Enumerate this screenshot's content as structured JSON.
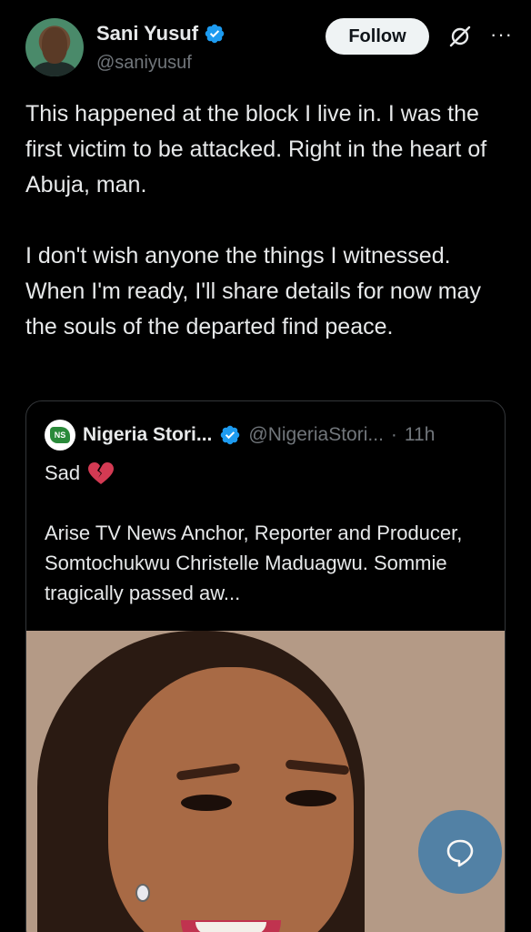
{
  "author": {
    "name": "Sani Yusuf",
    "handle": "@saniyusuf",
    "verified": true
  },
  "actions": {
    "follow_label": "Follow",
    "grok_icon": "grok-icon",
    "more_icon": "more-icon",
    "more_label": "···"
  },
  "tweet": {
    "paragraph1": "This happened at the block I live in. I was the first victim to be attacked. Right in the heart of Abuja, man.",
    "paragraph2": "I don't wish anyone the things I witnessed. When I'm ready, I'll share details for now may the souls of the departed find peace."
  },
  "quoted_tweet": {
    "name": "Nigeria Stori...",
    "handle": "@NigeriaStori...",
    "separator": "·",
    "time": "11h",
    "verified": true,
    "first_line": "Sad",
    "emoji": "broken-heart-icon",
    "body": "Arise TV News Anchor, Reporter and Producer, Somtochukwu Christelle Maduagwu. Sommie tragically passed aw..."
  },
  "colors": {
    "background": "#000000",
    "text": "#e7e9ea",
    "muted": "#71767b",
    "verified_blue": "#1d9bf0",
    "follow_bg": "#eff3f4",
    "fab_bg": "#4a7fa8"
  },
  "fab": {
    "icon": "reply-bubble-icon"
  }
}
